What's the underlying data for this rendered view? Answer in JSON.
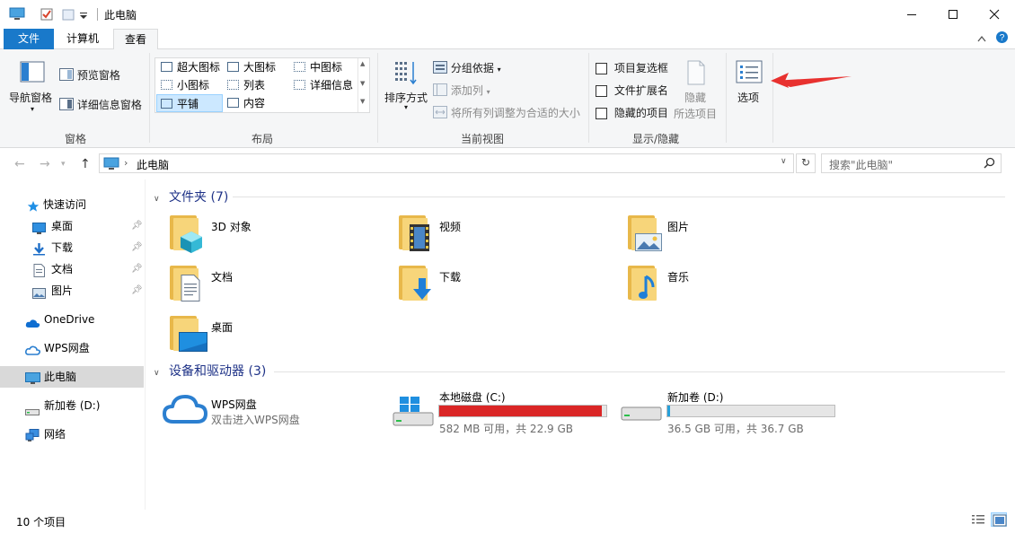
{
  "window": {
    "title": "此电脑"
  },
  "tabs": {
    "file": "文件",
    "computer": "计算机",
    "view": "查看"
  },
  "ribbon": {
    "panes": {
      "nav_pane": "导航窗格",
      "preview_pane": "预览窗格",
      "details_pane": "详细信息窗格",
      "group_label": "窗格"
    },
    "layout": {
      "items": [
        "超大图标",
        "大图标",
        "中图标",
        "小图标",
        "列表",
        "详细信息",
        "平铺",
        "内容"
      ],
      "selected": "平铺",
      "group_label": "布局"
    },
    "current_view": {
      "sort_by": "排序方式",
      "group_by": "分组依据",
      "add_columns": "添加列",
      "fit_columns": "将所有列调整为合适的大小",
      "group_label": "当前视图"
    },
    "show_hide": {
      "item_checkboxes": "项目复选框",
      "file_extensions": "文件扩展名",
      "hidden_items": "隐藏的项目",
      "hide_selected_line1": "隐藏",
      "hide_selected_line2": "所选项目",
      "group_label": "显示/隐藏"
    },
    "options": {
      "label": "选项"
    }
  },
  "address": {
    "location": "此电脑",
    "search_placeholder": "搜索\"此电脑\""
  },
  "navpane": {
    "quick_access": "快速访问",
    "items": [
      "桌面",
      "下载",
      "文档",
      "图片"
    ],
    "onedrive": "OneDrive",
    "wps_drive": "WPS网盘",
    "this_pc": "此电脑",
    "new_volume": "新加卷 (D:)",
    "network": "网络"
  },
  "content": {
    "folders_header": "文件夹 (7)",
    "folders": [
      "3D 对象",
      "视频",
      "图片",
      "文档",
      "下载",
      "音乐",
      "桌面"
    ],
    "devices_header": "设备和驱动器 (3)",
    "wps": {
      "name": "WPS网盘",
      "sub": "双击进入WPS网盘"
    },
    "drive_c": {
      "name": "本地磁盘 (C:)",
      "sub": "582 MB 可用，共 22.9 GB",
      "used_fraction": 0.975,
      "bar_color": "#da2626"
    },
    "drive_d": {
      "name": "新加卷 (D:)",
      "sub": "36.5 GB 可用，共 36.7 GB",
      "used_fraction": 0.006,
      "bar_color": "#26a0da"
    }
  },
  "status": {
    "count": "10 个项目"
  },
  "colors": {
    "accent": "#1979ca",
    "annotation_arrow": "#e8312f"
  }
}
